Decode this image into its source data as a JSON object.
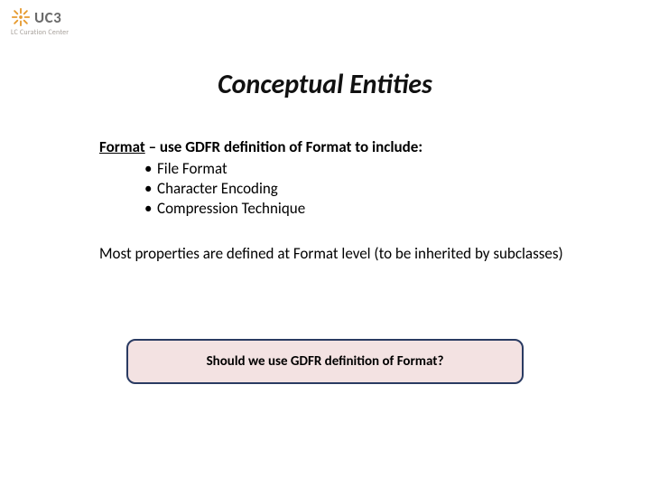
{
  "logo": {
    "label": "UC3",
    "sublabel": "LC Curation Center"
  },
  "title": "Conceptual Entities",
  "format": {
    "lead": "Format",
    "rest": " – use GDFR definition of Format to include:",
    "bullets": [
      "File Format",
      "Character Encoding",
      "Compression Technique"
    ]
  },
  "paragraph": "Most properties are defined at Format level (to be inherited by subclasses)",
  "callout": "Should we use GDFR definition of Format?"
}
